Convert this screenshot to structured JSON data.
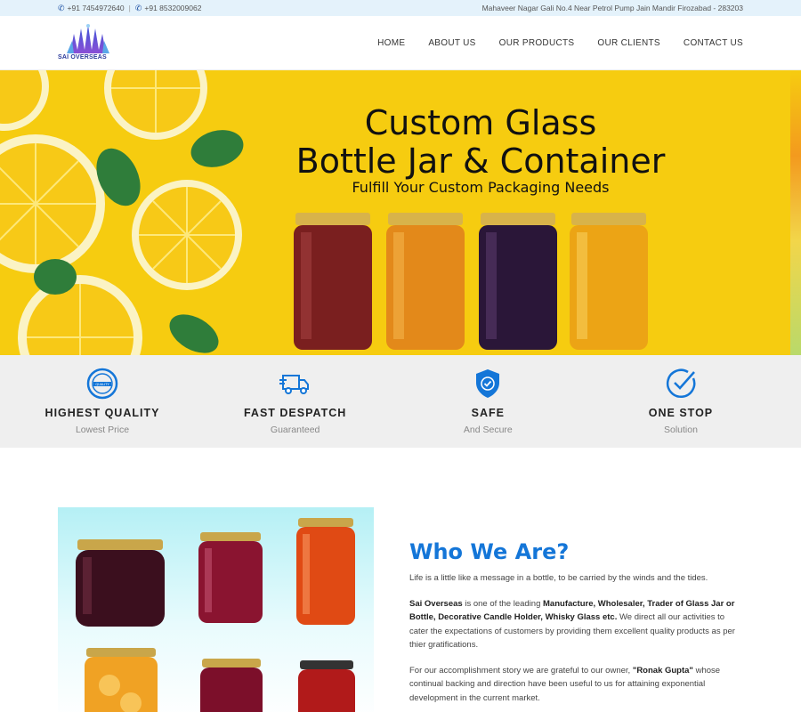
{
  "topbar": {
    "phone1": "+91 7454972640",
    "phone2": "+91 8532009062",
    "address": "Mahaveer Nagar Gali No.4 Near Petrol Pump Jain Mandir Firozabad - 283203"
  },
  "header": {
    "logo_text": "SAI OVERSEAS",
    "nav": [
      "HOME",
      "ABOUT US",
      "OUR PRODUCTS",
      "OUR CLIENTS",
      "CONTACT US"
    ]
  },
  "hero": {
    "line1": "Custom Glass",
    "line2": "Bottle Jar & Container",
    "subtitle": "Fulfill Your Custom Packaging Needs"
  },
  "features": [
    {
      "title": "HIGHEST QUALITY",
      "sub": "Lowest Price",
      "icon": "quality-badge-icon"
    },
    {
      "title": "FAST DESPATCH",
      "sub": "Guaranteed",
      "icon": "delivery-truck-icon"
    },
    {
      "title": "SAFE",
      "sub": "And Secure",
      "icon": "shield-check-icon"
    },
    {
      "title": "ONE STOP",
      "sub": "Solution",
      "icon": "circle-check-icon"
    }
  ],
  "about": {
    "heading": "Who We Are?",
    "p1": "Life is a little like a message in a bottle, to be carried by the winds and the tides.",
    "p2_company": "Sai Overseas",
    "p2_a": " is one of the leading ",
    "p2_b": "Manufacture, Wholesaler, Trader of Glass Jar or Bottle, Decorative Candle Holder, Whisky Glass etc.",
    "p2_c": " We direct all our activities to cater the expectations of customers by providing them excellent quality products as per thier gratifications.",
    "p3_a": "For our accomplishment story we are grateful to our owner, ",
    "p3_owner": "\"Ronak Gupta\"",
    "p3_b": " whose continual backing and direction have been useful to us for attaining exponential development in the current market."
  },
  "colors": {
    "topbar_bg": "#e4f2fb",
    "hero_bg": "#f6cc10",
    "accent_blue": "#1476d8",
    "features_bg": "#efefef"
  }
}
